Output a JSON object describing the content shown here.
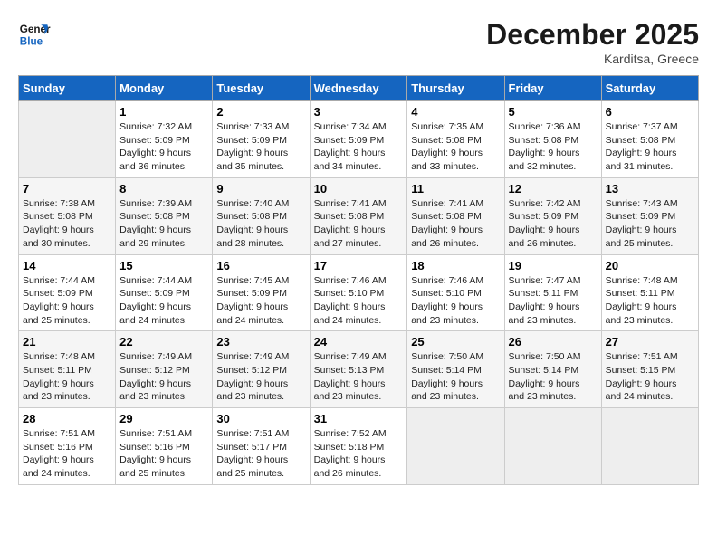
{
  "header": {
    "logo_general": "General",
    "logo_blue": "Blue",
    "month_title": "December 2025",
    "location": "Karditsa, Greece"
  },
  "days_of_week": [
    "Sunday",
    "Monday",
    "Tuesday",
    "Wednesday",
    "Thursday",
    "Friday",
    "Saturday"
  ],
  "weeks": [
    [
      {
        "day": "",
        "sunrise": "",
        "sunset": "",
        "daylight": ""
      },
      {
        "day": "1",
        "sunrise": "Sunrise: 7:32 AM",
        "sunset": "Sunset: 5:09 PM",
        "daylight": "Daylight: 9 hours and 36 minutes."
      },
      {
        "day": "2",
        "sunrise": "Sunrise: 7:33 AM",
        "sunset": "Sunset: 5:09 PM",
        "daylight": "Daylight: 9 hours and 35 minutes."
      },
      {
        "day": "3",
        "sunrise": "Sunrise: 7:34 AM",
        "sunset": "Sunset: 5:09 PM",
        "daylight": "Daylight: 9 hours and 34 minutes."
      },
      {
        "day": "4",
        "sunrise": "Sunrise: 7:35 AM",
        "sunset": "Sunset: 5:08 PM",
        "daylight": "Daylight: 9 hours and 33 minutes."
      },
      {
        "day": "5",
        "sunrise": "Sunrise: 7:36 AM",
        "sunset": "Sunset: 5:08 PM",
        "daylight": "Daylight: 9 hours and 32 minutes."
      },
      {
        "day": "6",
        "sunrise": "Sunrise: 7:37 AM",
        "sunset": "Sunset: 5:08 PM",
        "daylight": "Daylight: 9 hours and 31 minutes."
      }
    ],
    [
      {
        "day": "7",
        "sunrise": "Sunrise: 7:38 AM",
        "sunset": "Sunset: 5:08 PM",
        "daylight": "Daylight: 9 hours and 30 minutes."
      },
      {
        "day": "8",
        "sunrise": "Sunrise: 7:39 AM",
        "sunset": "Sunset: 5:08 PM",
        "daylight": "Daylight: 9 hours and 29 minutes."
      },
      {
        "day": "9",
        "sunrise": "Sunrise: 7:40 AM",
        "sunset": "Sunset: 5:08 PM",
        "daylight": "Daylight: 9 hours and 28 minutes."
      },
      {
        "day": "10",
        "sunrise": "Sunrise: 7:41 AM",
        "sunset": "Sunset: 5:08 PM",
        "daylight": "Daylight: 9 hours and 27 minutes."
      },
      {
        "day": "11",
        "sunrise": "Sunrise: 7:41 AM",
        "sunset": "Sunset: 5:08 PM",
        "daylight": "Daylight: 9 hours and 26 minutes."
      },
      {
        "day": "12",
        "sunrise": "Sunrise: 7:42 AM",
        "sunset": "Sunset: 5:09 PM",
        "daylight": "Daylight: 9 hours and 26 minutes."
      },
      {
        "day": "13",
        "sunrise": "Sunrise: 7:43 AM",
        "sunset": "Sunset: 5:09 PM",
        "daylight": "Daylight: 9 hours and 25 minutes."
      }
    ],
    [
      {
        "day": "14",
        "sunrise": "Sunrise: 7:44 AM",
        "sunset": "Sunset: 5:09 PM",
        "daylight": "Daylight: 9 hours and 25 minutes."
      },
      {
        "day": "15",
        "sunrise": "Sunrise: 7:44 AM",
        "sunset": "Sunset: 5:09 PM",
        "daylight": "Daylight: 9 hours and 24 minutes."
      },
      {
        "day": "16",
        "sunrise": "Sunrise: 7:45 AM",
        "sunset": "Sunset: 5:09 PM",
        "daylight": "Daylight: 9 hours and 24 minutes."
      },
      {
        "day": "17",
        "sunrise": "Sunrise: 7:46 AM",
        "sunset": "Sunset: 5:10 PM",
        "daylight": "Daylight: 9 hours and 24 minutes."
      },
      {
        "day": "18",
        "sunrise": "Sunrise: 7:46 AM",
        "sunset": "Sunset: 5:10 PM",
        "daylight": "Daylight: 9 hours and 23 minutes."
      },
      {
        "day": "19",
        "sunrise": "Sunrise: 7:47 AM",
        "sunset": "Sunset: 5:11 PM",
        "daylight": "Daylight: 9 hours and 23 minutes."
      },
      {
        "day": "20",
        "sunrise": "Sunrise: 7:48 AM",
        "sunset": "Sunset: 5:11 PM",
        "daylight": "Daylight: 9 hours and 23 minutes."
      }
    ],
    [
      {
        "day": "21",
        "sunrise": "Sunrise: 7:48 AM",
        "sunset": "Sunset: 5:11 PM",
        "daylight": "Daylight: 9 hours and 23 minutes."
      },
      {
        "day": "22",
        "sunrise": "Sunrise: 7:49 AM",
        "sunset": "Sunset: 5:12 PM",
        "daylight": "Daylight: 9 hours and 23 minutes."
      },
      {
        "day": "23",
        "sunrise": "Sunrise: 7:49 AM",
        "sunset": "Sunset: 5:12 PM",
        "daylight": "Daylight: 9 hours and 23 minutes."
      },
      {
        "day": "24",
        "sunrise": "Sunrise: 7:49 AM",
        "sunset": "Sunset: 5:13 PM",
        "daylight": "Daylight: 9 hours and 23 minutes."
      },
      {
        "day": "25",
        "sunrise": "Sunrise: 7:50 AM",
        "sunset": "Sunset: 5:14 PM",
        "daylight": "Daylight: 9 hours and 23 minutes."
      },
      {
        "day": "26",
        "sunrise": "Sunrise: 7:50 AM",
        "sunset": "Sunset: 5:14 PM",
        "daylight": "Daylight: 9 hours and 23 minutes."
      },
      {
        "day": "27",
        "sunrise": "Sunrise: 7:51 AM",
        "sunset": "Sunset: 5:15 PM",
        "daylight": "Daylight: 9 hours and 24 minutes."
      }
    ],
    [
      {
        "day": "28",
        "sunrise": "Sunrise: 7:51 AM",
        "sunset": "Sunset: 5:16 PM",
        "daylight": "Daylight: 9 hours and 24 minutes."
      },
      {
        "day": "29",
        "sunrise": "Sunrise: 7:51 AM",
        "sunset": "Sunset: 5:16 PM",
        "daylight": "Daylight: 9 hours and 25 minutes."
      },
      {
        "day": "30",
        "sunrise": "Sunrise: 7:51 AM",
        "sunset": "Sunset: 5:17 PM",
        "daylight": "Daylight: 9 hours and 25 minutes."
      },
      {
        "day": "31",
        "sunrise": "Sunrise: 7:52 AM",
        "sunset": "Sunset: 5:18 PM",
        "daylight": "Daylight: 9 hours and 26 minutes."
      },
      {
        "day": "",
        "sunrise": "",
        "sunset": "",
        "daylight": ""
      },
      {
        "day": "",
        "sunrise": "",
        "sunset": "",
        "daylight": ""
      },
      {
        "day": "",
        "sunrise": "",
        "sunset": "",
        "daylight": ""
      }
    ]
  ]
}
